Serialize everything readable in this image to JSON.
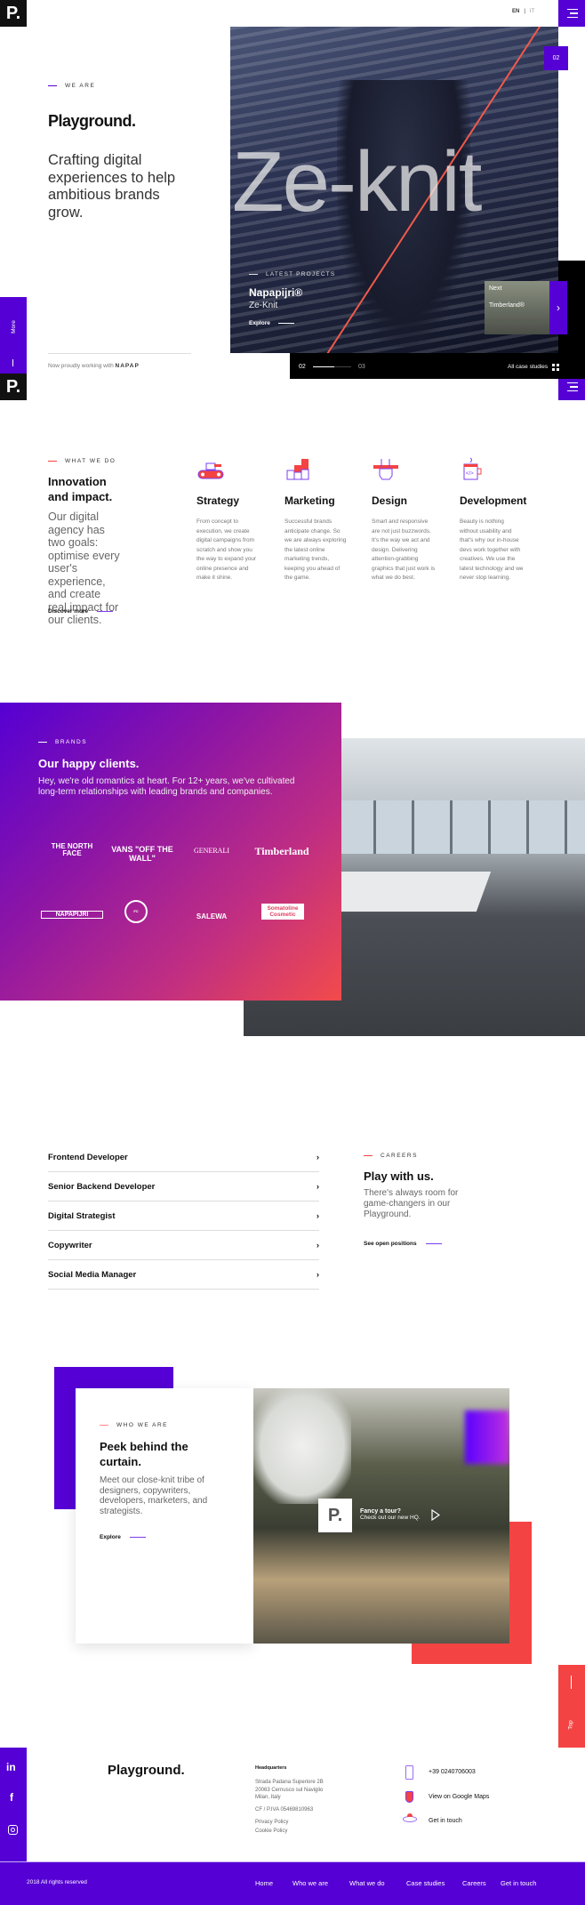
{
  "header": {
    "logo": "P.",
    "lang": [
      "EN",
      "IT"
    ]
  },
  "hero": {
    "eyebrow": "We are",
    "brand": "Playground.",
    "tagline": "Crafting digital experiences to help ambitious brands grow.",
    "more_label": "More",
    "working_with_label": "Now proudly working with",
    "working_with_brand": "NAPAP",
    "slide_tag": "02",
    "big_title": "Ze-knit",
    "project_eyebrow": "Latest projects",
    "project_client": "Napapijri®",
    "project_name": "Ze-Knit",
    "explore_label": "Explore",
    "next_label": "Next",
    "next_client": "Timberland®",
    "current_slide": "02",
    "next_slide": "03",
    "progress": 0.55,
    "all_cases_label": "All case studies"
  },
  "what_we_do": {
    "eyebrow": "What we do",
    "title": "Innovation and impact.",
    "text": "Our digital agency has two goals: optimise every user's experience, and create real impact for our clients.",
    "link": "Discover more",
    "services": [
      {
        "title": "Strategy",
        "icon": "conveyor-icon",
        "text": "From concept to execution, we create digital campaigns from scratch and show you the way to expand your online presence and make it shine."
      },
      {
        "title": "Marketing",
        "icon": "blocks-icon",
        "text": "Successful brands anticipate change. So we are always exploring the latest online marketing trends, keeping you ahead of the game."
      },
      {
        "title": "Design",
        "icon": "hand-pencil-icon",
        "text": "Smart and responsive are not just buzzwords. It's the way we act and design. Delivering attention-grabbing graphics that just work is what we do best."
      },
      {
        "title": "Development",
        "icon": "code-mug-icon",
        "text": "Beauty is nothing without usability and that's why our in-house devs work together with creatives. We use the latest technology and we never stop learning."
      }
    ]
  },
  "brands": {
    "eyebrow": "Brands",
    "title": "Our happy clients.",
    "text": "Hey, we're old romantics at heart. For 12+ years, we've cultivated long-term relationships with leading brands and companies.",
    "logos": [
      "THE NORTH FACE",
      "VANS \"OFF THE WALL\"",
      "GENERALI",
      "Timberland",
      "NAPAPIJRI",
      "FC INTERNAZIONALE",
      "SALEWA",
      "Somatoline Cosmetic"
    ]
  },
  "careers": {
    "jobs": [
      "Frontend Developer",
      "Senior Backend Developer",
      "Digital Strategist",
      "Copywriter",
      "Social Media Manager"
    ],
    "eyebrow": "Careers",
    "title": "Play with us.",
    "text": "There's always room for game-changers in our Playground.",
    "link": "See open positions"
  },
  "who": {
    "eyebrow": "Who we are",
    "title": "Peek behind the curtain.",
    "text": "Meet our close-knit tribe of designers, copywriters, developers, marketers, and strategists.",
    "link": "Explore",
    "tour_title": "Fancy a tour?",
    "tour_sub": "Check out our new HQ.",
    "top_label": "Top"
  },
  "footer": {
    "brand": "Playground.",
    "hq_title": "Headquarters",
    "address": [
      "Strada Padana Superiore 2B",
      "20063 Cernusco sul Naviglio",
      "Milan, Italy"
    ],
    "vat": "CF / P.IVA 05469810963",
    "privacy": "Privacy Policy",
    "cookie": "Cookie Policy",
    "phone": "+39 0240706003",
    "maps": "View on Google Maps",
    "contact": "Get in touch",
    "copyright": "2018 All rights reserved",
    "nav": [
      "Home",
      "Who we are",
      "What we do",
      "Case studies",
      "Careers",
      "Get in touch"
    ],
    "social": [
      "linkedin-icon",
      "facebook-icon",
      "instagram-icon"
    ]
  },
  "colors": {
    "accent": "#5500d4",
    "red": "#f44343"
  }
}
